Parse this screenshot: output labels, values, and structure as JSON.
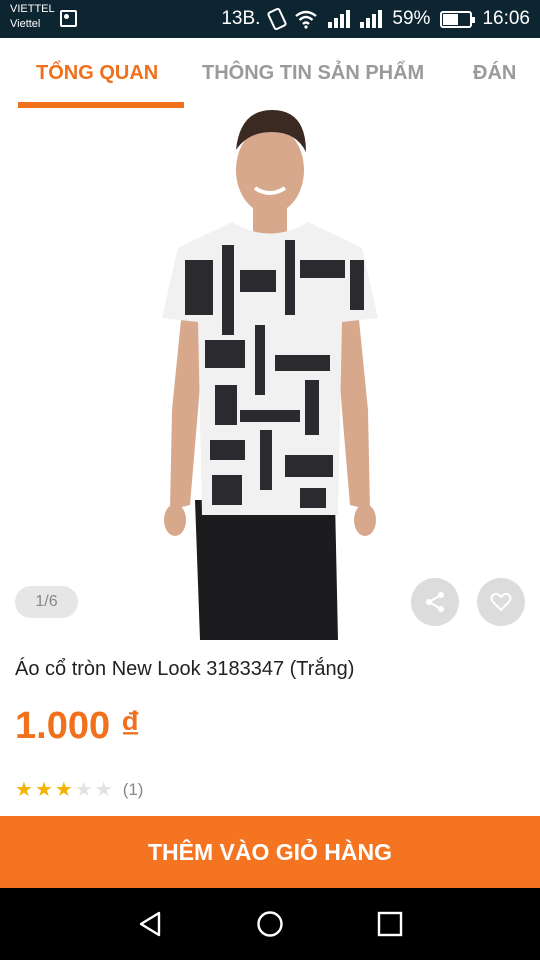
{
  "status_bar": {
    "carrier_top": "VIETTEL",
    "carrier_bottom": "Viettel",
    "network_label": "13B.",
    "battery_percent": "59%",
    "battery_level": 0.59,
    "time": "16:06",
    "icons": [
      "image-icon",
      "vibrate-icon",
      "wifi-icon",
      "signal-icon",
      "signal-icon",
      "battery-icon"
    ]
  },
  "tabs": [
    {
      "label": "TỔNG QUAN",
      "active": true
    },
    {
      "label": "THÔNG TIN SẢN PHẨM",
      "active": false
    },
    {
      "label": "ĐÁN",
      "active": false
    }
  ],
  "gallery": {
    "counter": "1/6",
    "actions": [
      "share-icon",
      "heart-icon"
    ]
  },
  "product": {
    "title": "Áo cổ tròn New Look 3183347 (Trắng)",
    "price": "1.000 ₫",
    "rating": 3,
    "rating_max": 5,
    "review_count": "(1)"
  },
  "cta": {
    "label": "THÊM VÀO GIỎ HÀNG"
  },
  "nav": {
    "icons": [
      "back-icon",
      "home-icon",
      "recents-icon"
    ]
  },
  "colors": {
    "accent": "#f0701c",
    "cta": "#f57421",
    "status_bar": "#0d2530",
    "star": "#f5b301"
  }
}
